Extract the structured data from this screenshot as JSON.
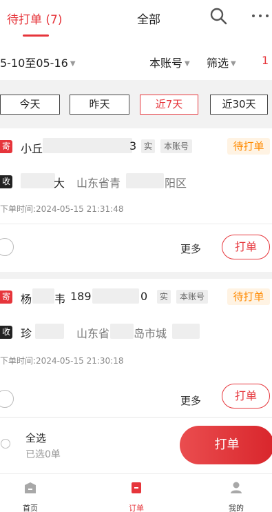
{
  "header": {
    "tab_pending": "待打单 (7)",
    "tab_all": "全部"
  },
  "filters": {
    "date_range": "5-10至05-16",
    "account": "本账号",
    "screen": "筛选",
    "sort": "1"
  },
  "quick_dates": [
    "今天",
    "昨天",
    "近7天",
    "近30天"
  ],
  "quick_dates_active": "近7天",
  "orders": [
    {
      "sender_badge": "寄",
      "sender_name_start": "小丘",
      "sender_phone_end": "3",
      "real_tag": "实",
      "account_tag": "本账号",
      "status": "待打单",
      "recv_badge": "收",
      "recv_name_end": "大",
      "recv_addr_start": "山东省青",
      "recv_addr_end": "阳区",
      "order_time": "下单时间:2024-05-15 21:31:48",
      "more": "更多",
      "print": "打单"
    },
    {
      "sender_badge": "寄",
      "sender_name_start": "杨",
      "sender_name_end": "韦",
      "sender_phone_start": "189",
      "sender_phone_end": "0",
      "real_tag": "实",
      "account_tag": "本账号",
      "status": "待打单",
      "recv_badge": "收",
      "recv_name_start": "珍",
      "recv_addr_start": "山东省",
      "recv_addr_end": "岛市城",
      "order_time": "下单时间:2024-05-15 21:30:18",
      "more": "更多",
      "print": "打单"
    }
  ],
  "bottom_bar": {
    "select_all": "全选",
    "selected_count": "已选0单",
    "print": "打单"
  },
  "nav": {
    "home": "首页",
    "orders": "订单",
    "mine": "我的"
  },
  "colors": {
    "accent": "#e6353b",
    "status": "#ff8a00"
  }
}
